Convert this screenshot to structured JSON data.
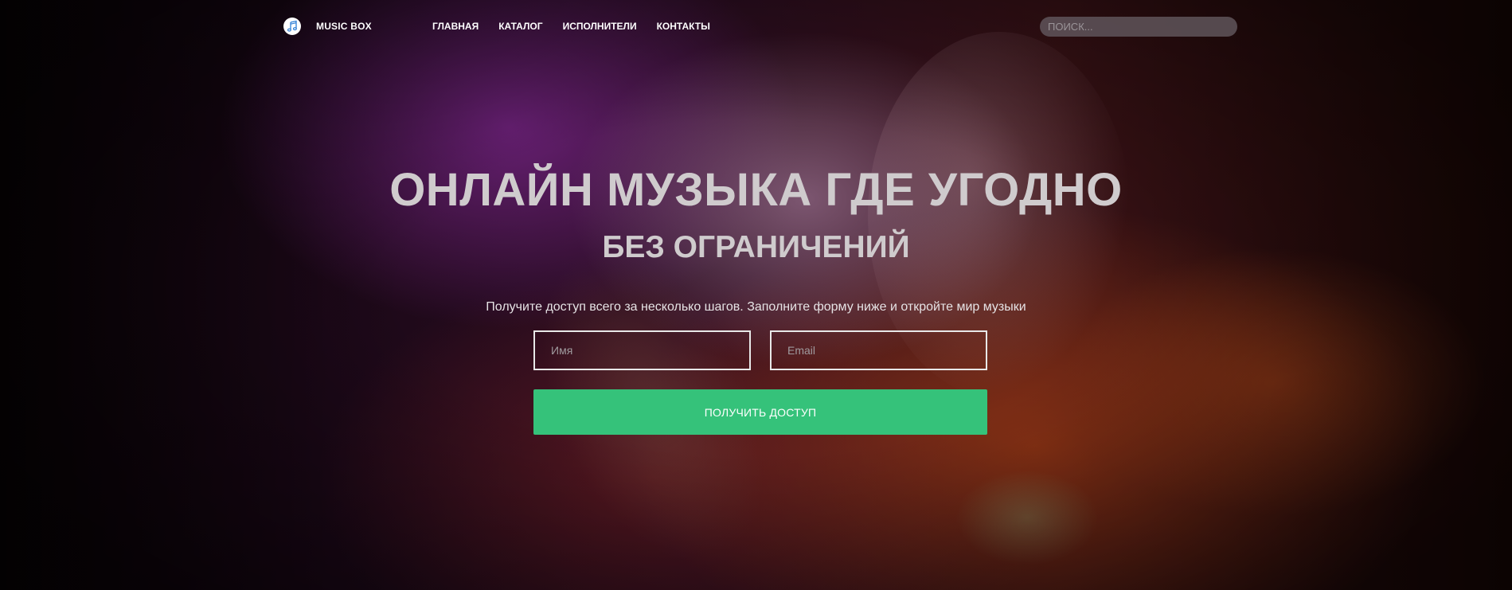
{
  "navbar": {
    "logo_icon": "music-note-icon",
    "brand": "MUSIC BOX",
    "links": [
      {
        "label": "ГЛАВНАЯ"
      },
      {
        "label": "КАТАЛОГ"
      },
      {
        "label": "ИСПОЛНИТЕЛИ"
      },
      {
        "label": "КОНТАКТЫ"
      }
    ],
    "search": {
      "placeholder": "ПОИСК...",
      "value": ""
    }
  },
  "hero": {
    "title": "ОНЛАЙН МУЗЫКА ГДЕ УГОДНО",
    "subtitle": "БЕЗ ОГРАНИЧЕНИЙ",
    "lead": "Получите доступ всего за несколько шагов. Заполните форму ниже и откройте мир музыки",
    "form": {
      "name_placeholder": "Имя",
      "name_value": "",
      "email_placeholder": "Email",
      "email_value": "",
      "submit_label": "ПОЛУЧИТЬ ДОСТУП"
    }
  },
  "colors": {
    "accent": "#35c27a",
    "logo_icon": "#2f7fd6",
    "text": "#cfcbcd"
  }
}
